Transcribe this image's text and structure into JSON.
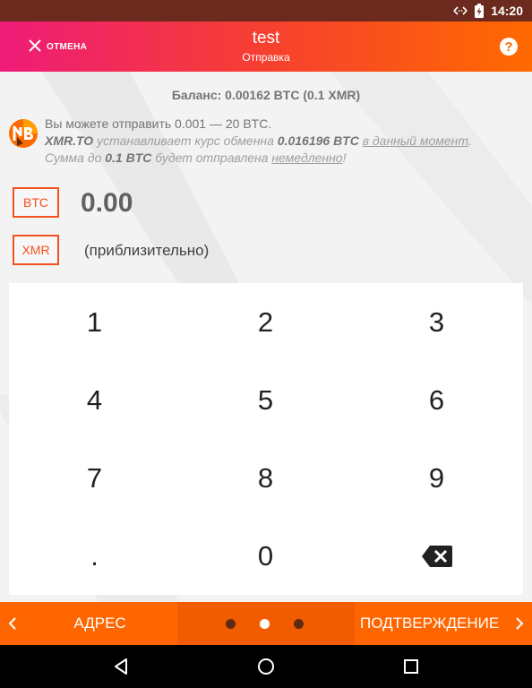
{
  "status_bar": {
    "time": "14:20",
    "icons": [
      "data-transfer-icon",
      "battery-charging-icon"
    ]
  },
  "toolbar": {
    "cancel_label": "ОТМЕНА",
    "title": "test",
    "subtitle": "Отправка",
    "help_icon_text": "?"
  },
  "balance": "Баланс: 0.00162 BTC (0.1 XMR)",
  "info": {
    "line1": "Вы можете отправить 0.001 — 20 BTC.",
    "line2": {
      "service": "XMR.TO",
      "text1": " устанавливает курс обменна ",
      "rate": "0.016196 BTC",
      "link": "в данный момент",
      "end": "."
    },
    "line3": {
      "text1": "Сумма до ",
      "limit": "0.1 BTC",
      "text2": " будет отправлена ",
      "link": "немедленно",
      "end": "!"
    }
  },
  "currency": {
    "btc_label": "BTC",
    "btc_amount": "0.00",
    "xmr_label": "XMR",
    "xmr_amount": "(приблизительно)"
  },
  "keypad": {
    "keys": [
      "1",
      "2",
      "3",
      "4",
      "5",
      "6",
      "7",
      "8",
      "9",
      ".",
      "0"
    ],
    "backspace_icon": "backspace-icon"
  },
  "bottom_nav": {
    "prev_label": "АДРЕС",
    "next_label": "ПОДТВЕРЖДЕНИЕ",
    "pages": 3,
    "active_page": 2
  },
  "colors": {
    "accent": "#ff6600",
    "gradient_start": "#ee1b79",
    "gradient_end": "#ff6a00",
    "status_bar": "#6b2a1d",
    "currency_border": "#f4511e"
  }
}
